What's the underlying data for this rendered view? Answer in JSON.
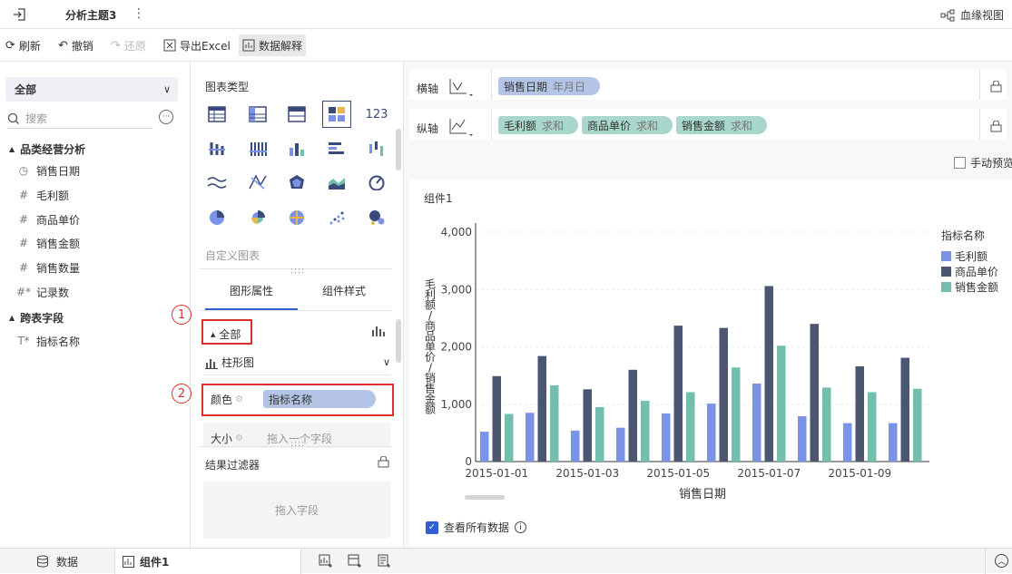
{
  "titlebar": {
    "title": "分析主题3",
    "lineage_label": "血缘视图"
  },
  "toolbar": {
    "refresh": "刷新",
    "undo": "撤销",
    "redo": "还原",
    "export": "导出Excel",
    "explain": "数据解释"
  },
  "left": {
    "scope": "全部",
    "search_placeholder": "搜索",
    "group1": "品类经营分析",
    "fields": [
      {
        "icon": "clock-icon",
        "label": "销售日期"
      },
      {
        "icon": "hash-icon",
        "label": "毛利额"
      },
      {
        "icon": "hash-icon",
        "label": "商品单价"
      },
      {
        "icon": "hash-icon",
        "label": "销售金额"
      },
      {
        "icon": "hash-icon",
        "label": "销售数量"
      },
      {
        "icon": "hash-star-icon",
        "label": "记录数"
      }
    ],
    "group2": "跨表字段",
    "group2_field": "指标名称"
  },
  "mid": {
    "chart_type_title": "图表类型",
    "custom_chart": "自定义图表",
    "tab_shape": "图形属性",
    "tab_style": "组件样式",
    "scope": "全部",
    "chart_kind": "柱形图",
    "color_label": "颜色",
    "color_field": "指标名称",
    "size_label": "大小",
    "size_placeholder": "拖入一个字段",
    "filter_title": "结果过滤器",
    "filter_placeholder": "拖入字段",
    "annot1": "1",
    "annot2": "2"
  },
  "axes": {
    "x_label": "横轴",
    "x_field": "销售日期",
    "x_agg": "年月日",
    "y_label": "纵轴",
    "y_fields": [
      {
        "name": "毛利额",
        "agg": "求和"
      },
      {
        "name": "商品单价",
        "agg": "求和"
      },
      {
        "name": "销售金额",
        "agg": "求和"
      }
    ],
    "manual_preview": "手动预览"
  },
  "widget": {
    "title": "组件1",
    "view_all": "查看所有数据"
  },
  "colors": {
    "s1": "#7b93e6",
    "s2": "#4b5673",
    "s3": "#72bfae",
    "accent": "#2f5fd0"
  },
  "chart_data": {
    "type": "bar",
    "xlabel": "销售日期",
    "ylabel": "毛利额/商品单价/销售金额",
    "ylim": [
      0,
      4000
    ],
    "yticks": [
      "4,000",
      "3,000",
      "2,000",
      "1,000",
      "0"
    ],
    "ytick_values": [
      4000,
      3000,
      2000,
      1000,
      0
    ],
    "legend_title": "指标名称",
    "legend_position": "right",
    "xtick_labels": [
      "2015-01-01",
      "2015-01-03",
      "2015-01-05",
      "2015-01-07",
      "2015-01-09"
    ],
    "xtick_indices": [
      0,
      2,
      4,
      6,
      8
    ],
    "categories": [
      "2015-01-01",
      "2015-01-02",
      "2015-01-03",
      "2015-01-04",
      "2015-01-05",
      "2015-01-06",
      "2015-01-07",
      "2015-01-08",
      "2015-01-09",
      "2015-01-10"
    ],
    "series": [
      {
        "name": "毛利额",
        "values": [
          520,
          850,
          540,
          590,
          840,
          1010,
          1360,
          790,
          670,
          670
        ]
      },
      {
        "name": "商品单价",
        "values": [
          1490,
          1840,
          1260,
          1600,
          2370,
          2330,
          3060,
          2400,
          1660,
          1810
        ]
      },
      {
        "name": "销售金额",
        "values": [
          830,
          1330,
          950,
          1060,
          1210,
          1640,
          2020,
          1290,
          1210,
          1270
        ]
      }
    ]
  },
  "bottom": {
    "data_tab": "数据",
    "widget_tab": "组件1"
  }
}
